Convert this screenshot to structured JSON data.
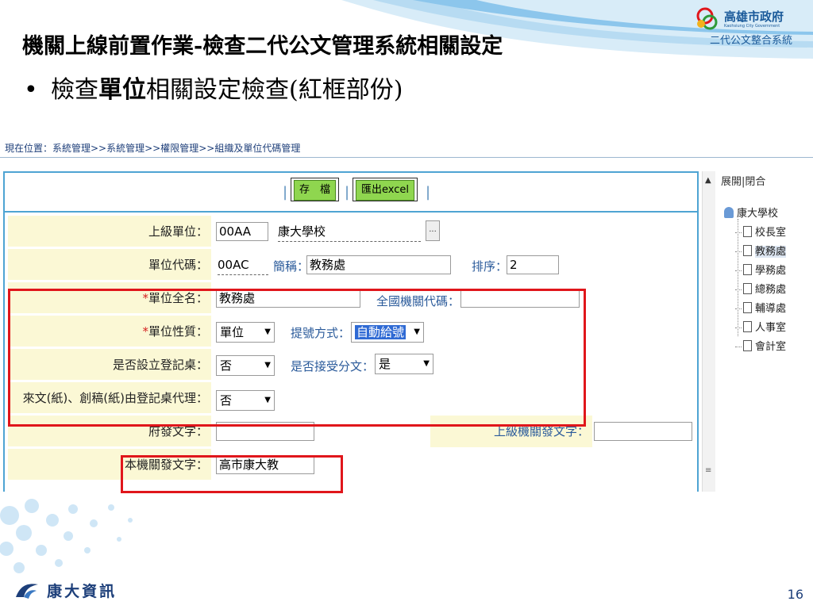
{
  "header": {
    "logo_line1": "高雄市政府",
    "logo_line2": "Kaohsiung City Government",
    "logo_line3": "二代公文整合系統"
  },
  "slide": {
    "title": "機關上線前置作業-檢查二代公文管理系統相關設定",
    "bullet_pre": "檢查",
    "bullet_bold": "單位",
    "bullet_post": "相關設定檢查(紅框部份)",
    "page_number": "16"
  },
  "footer": {
    "company": "康大資訊"
  },
  "screenshot": {
    "breadcrumb": "現在位置：系統管理>>系統管理>>權限管理>>組織及單位代碼管理",
    "toolbar": {
      "save": "存　檔",
      "export": "匯出excel"
    },
    "form": {
      "parent_unit_label": "上級單位：",
      "parent_unit_code": "00AA",
      "parent_unit_name": "康大學校",
      "pick_button": "...",
      "unit_code_label": "單位代碼：",
      "unit_code": "00AC",
      "short_name_label": "簡稱：",
      "short_name": "教務處",
      "order_label": "排序：",
      "order": "2",
      "full_name_label": "單位全名：",
      "full_name": "教務處",
      "national_code_label": "全國機關代碼：",
      "national_code": "",
      "nature_label": "單位性質：",
      "nature": "單位",
      "numbering_label": "提號方式：",
      "numbering": "自動給號",
      "registry_label": "是否設立登記桌：",
      "registry": "否",
      "accept_split_label": "是否接受分文：",
      "accept_split": "是",
      "proxy_label": "來文(紙)、創稿(紙)由登記桌代理：",
      "proxy": "否",
      "gov_text_label": "府發文字：",
      "gov_text": "",
      "upper_text_label": "上級機關發文字：",
      "upper_text": "",
      "own_text_label": "本機關發文字：",
      "own_text": "高市康大教"
    },
    "tree": {
      "toggle": "展開|閉合",
      "root": "康大學校",
      "items": [
        "校長室",
        "教務處",
        "學務處",
        "總務處",
        "輔導處",
        "人事室",
        "會計室"
      ],
      "selected": "教務處"
    }
  },
  "colors": {
    "accent_blue": "#4ea4d3",
    "label_bg": "#fbf8d5",
    "highlight_red": "#e0161b",
    "button_green": "#8fd64f"
  }
}
